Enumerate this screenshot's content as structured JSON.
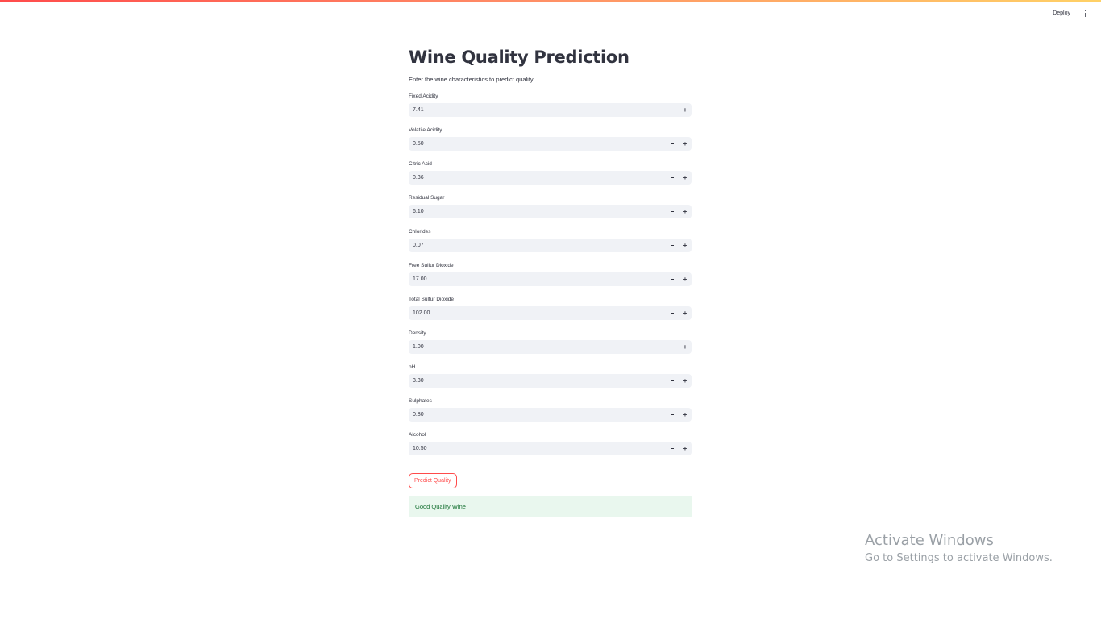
{
  "header": {
    "deploy_label": "Deploy",
    "menu_icon": "more-vertical-icon"
  },
  "page": {
    "title": "Wine Quality Prediction",
    "subtitle": "Enter the wine characteristics to predict quality"
  },
  "fields": [
    {
      "label": "Fixed Acidity",
      "value": "7.41"
    },
    {
      "label": "Volatile Acidity",
      "value": "0.50"
    },
    {
      "label": "Citric Acid",
      "value": "0.36"
    },
    {
      "label": "Residual Sugar",
      "value": "6.10"
    },
    {
      "label": "Chlorides",
      "value": "0.07"
    },
    {
      "label": "Free Sulfur Dioxide",
      "value": "17.00"
    },
    {
      "label": "Total Sulfur Dioxide",
      "value": "102.00"
    },
    {
      "label": "Density",
      "value": "1.00"
    },
    {
      "label": "pH",
      "value": "3.30"
    },
    {
      "label": "Sulphates",
      "value": "0.80"
    },
    {
      "label": "Alcohol",
      "value": "10.50"
    }
  ],
  "stepper_icons": {
    "decrement": "minus-icon",
    "increment": "plus-icon"
  },
  "predict_button_label": "Predict Quality",
  "result_message": "Good Quality Wine",
  "watermark": {
    "title": "Activate Windows",
    "subtitle": "Go to Settings to activate Windows."
  },
  "colors": {
    "accent": "#ff4b4b",
    "success_bg": "#e9f7ee",
    "success_text": "#177233",
    "input_bg": "#f0f2f6"
  }
}
